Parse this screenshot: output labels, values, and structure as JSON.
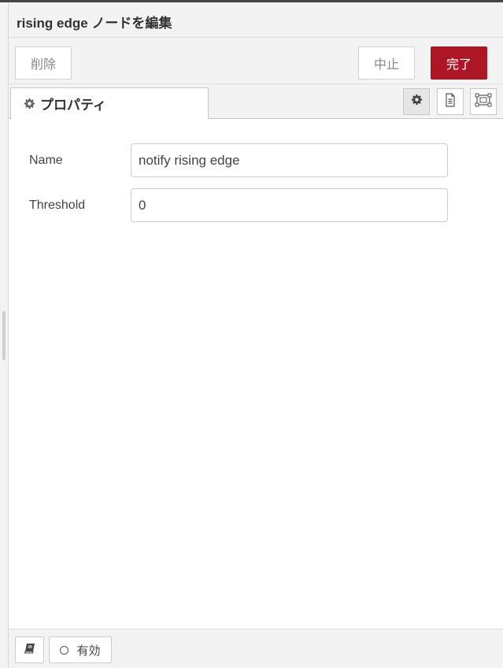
{
  "dialog": {
    "title": "rising edge ノードを編集"
  },
  "toolbar": {
    "delete_label": "削除",
    "cancel_label": "中止",
    "done_label": "完了"
  },
  "tabs": [
    {
      "label": "プロパティ",
      "icon": "gear-icon",
      "active": true
    }
  ],
  "tab_icons": [
    {
      "name": "gear-icon",
      "active": true
    },
    {
      "name": "document-icon",
      "active": false
    },
    {
      "name": "frame-icon",
      "active": false
    }
  ],
  "form": {
    "name": {
      "label": "Name",
      "value": "notify rising edge"
    },
    "threshold": {
      "label": "Threshold",
      "value": "0"
    }
  },
  "footer": {
    "help_icon": "book-icon",
    "enable_label": "有効",
    "enabled": false
  },
  "colors": {
    "done_button": "#ad1625",
    "background": "#f3f3f3"
  }
}
